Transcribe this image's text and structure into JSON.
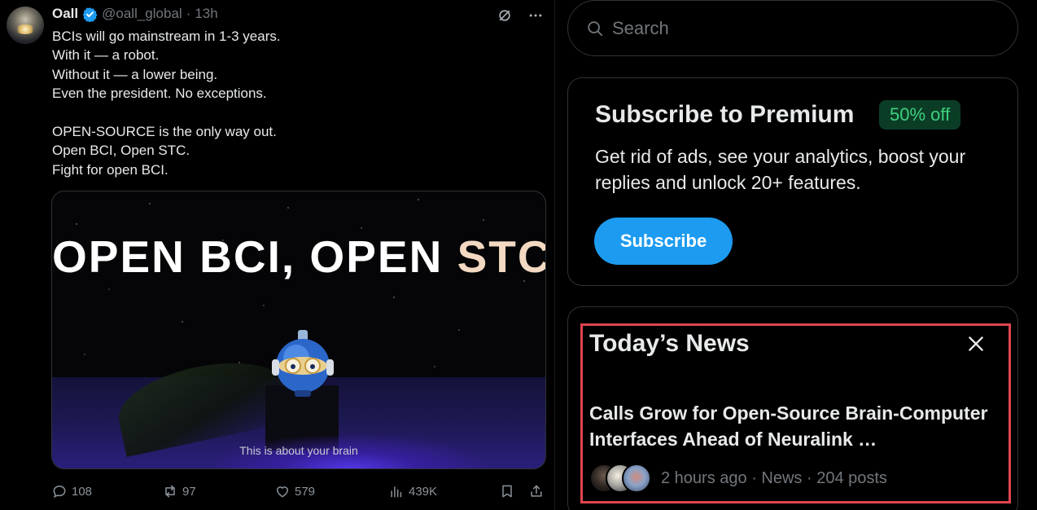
{
  "tweet": {
    "author_name": "Oall",
    "handle": "@oall_global",
    "separator": "·",
    "time": "13h",
    "lines": [
      "BCIs will go mainstream in 1-3 years.",
      "With it — a robot.",
      "Without it — a lower being.",
      "Even the president. No exceptions.",
      "",
      "OPEN-SOURCE is the only way out.",
      "Open BCI, Open STC.",
      "Fight for open BCI."
    ],
    "media": {
      "title_part1": "OPEN BCI, OPEN ",
      "title_part2": "STC!",
      "caption": "This is about your brain"
    },
    "stats": {
      "replies": "108",
      "reposts": "97",
      "likes": "579",
      "views": "439K"
    }
  },
  "sidebar": {
    "search": {
      "placeholder": "Search"
    },
    "premium": {
      "title": "Subscribe to Premium",
      "badge": "50% off",
      "description": "Get rid of ads, see your analytics, boost your replies and unlock 20+ features.",
      "button": "Subscribe"
    },
    "news": {
      "title": "Today’s News",
      "headline": "Calls Grow for Open-Source Brain-Computer Interfaces Ahead of Neuralink …",
      "meta": "2 hours ago · News · 204 posts"
    }
  },
  "colors": {
    "accent_blue": "#1d9bf0",
    "badge_green": "#3fd07f",
    "highlight_red": "#e0454f"
  }
}
